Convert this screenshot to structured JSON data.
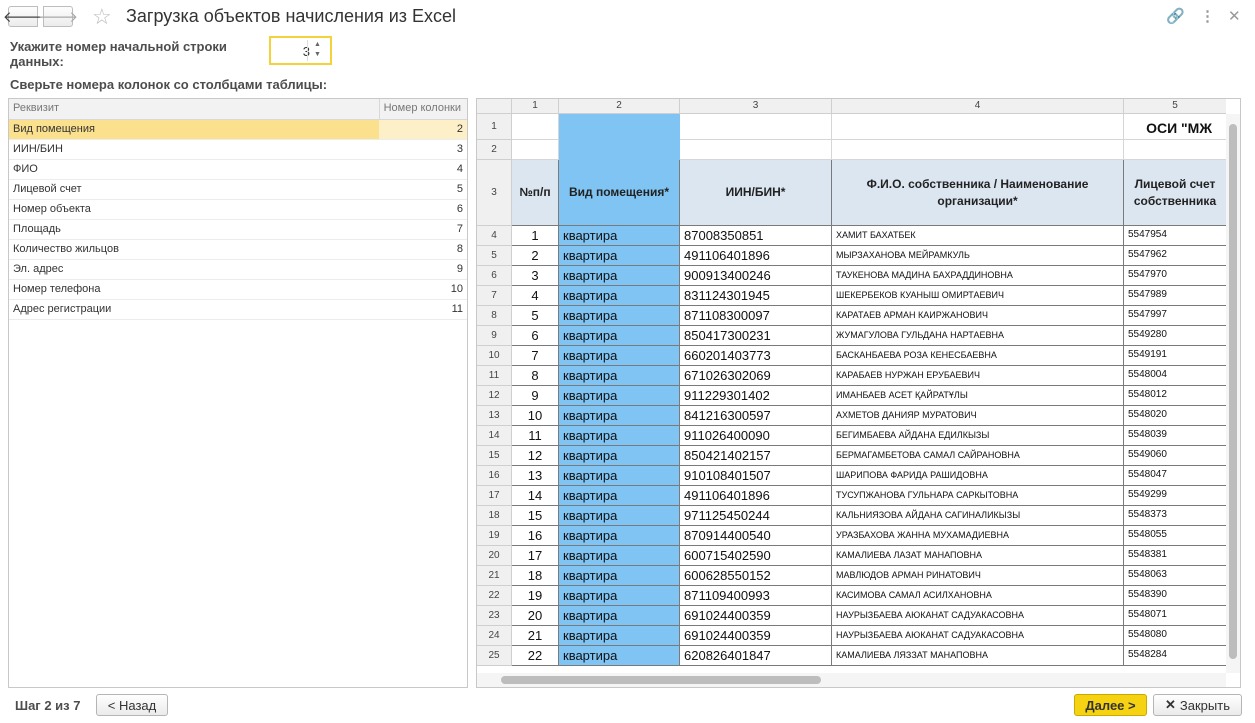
{
  "window": {
    "title": "Загрузка объектов начисления из Excel"
  },
  "form": {
    "start_row_label": "Укажите номер начальной строки данных:",
    "start_row_value": "3",
    "columns_label": "Сверьте номера колонок со столбцами таблицы:"
  },
  "mapping": {
    "headers": [
      "Реквизит",
      "Номер колонки"
    ],
    "rows": [
      {
        "name": "Вид помещения",
        "col": "2"
      },
      {
        "name": "ИИН/БИН",
        "col": "3"
      },
      {
        "name": "ФИО",
        "col": "4"
      },
      {
        "name": "Лицевой счет",
        "col": "5"
      },
      {
        "name": "Номер объекта",
        "col": "6"
      },
      {
        "name": "Площадь",
        "col": "7"
      },
      {
        "name": "Количество жильцов",
        "col": "8"
      },
      {
        "name": "Эл. адрес",
        "col": "9"
      },
      {
        "name": "Номер телефона",
        "col": "10"
      },
      {
        "name": "Адрес регистрации",
        "col": "11"
      }
    ]
  },
  "sheet": {
    "col_numbers": [
      "1",
      "2",
      "3",
      "4",
      "5"
    ],
    "row1_text": "ОСИ \"МЖ",
    "headers": [
      "№п/п",
      "Вид помещения*",
      "ИИН/БИН*",
      "Ф.И.О. собственника / Наименование организации*",
      "Лицевой счет собственника"
    ],
    "rows": [
      {
        "n": "1",
        "kind": "квартира",
        "iin": "87008350851",
        "fio": "ХАМИТ БАХАТБЕК",
        "acc": "5547954"
      },
      {
        "n": "2",
        "kind": "квартира",
        "iin": "491106401896",
        "fio": "МЫРЗАХАНОВА МЕЙРАМКУЛЬ",
        "acc": "5547962"
      },
      {
        "n": "3",
        "kind": "квартира",
        "iin": "900913400246",
        "fio": "ТАУКЕНОВА МАДИНА БАХРАДДИНОВНА",
        "acc": "5547970"
      },
      {
        "n": "4",
        "kind": "квартира",
        "iin": "831124301945",
        "fio": "ШЕКЕРБЕКОВ КУАНЫШ ОМИРТАЕВИЧ",
        "acc": "5547989"
      },
      {
        "n": "5",
        "kind": "квартира",
        "iin": "871108300097",
        "fio": "КАРАТАЕВ АРМАН КАИРЖАНОВИЧ",
        "acc": "5547997"
      },
      {
        "n": "6",
        "kind": "квартира",
        "iin": "850417300231",
        "fio": "ЖУМАГУЛОВА ГУЛЬДАНА НАРТАЕВНА",
        "acc": "5549280"
      },
      {
        "n": "7",
        "kind": "квартира",
        "iin": "660201403773",
        "fio": "БАСКАНБАЕВА РОЗА КЕНЕСБАЕВНА",
        "acc": "5549191"
      },
      {
        "n": "8",
        "kind": "квартира",
        "iin": "671026302069",
        "fio": "КАРАБАЕВ НУРЖАН ЕРУБАЕВИЧ",
        "acc": "5548004"
      },
      {
        "n": "9",
        "kind": "квартира",
        "iin": "911229301402",
        "fio": "ИМАНБАЕВ АСЕТ ҚАЙРАТҰЛЫ",
        "acc": "5548012"
      },
      {
        "n": "10",
        "kind": "квартира",
        "iin": "841216300597",
        "fio": "АХМЕТОВ ДАНИЯР МУРАТОВИЧ",
        "acc": "5548020"
      },
      {
        "n": "11",
        "kind": "квартира",
        "iin": "911026400090",
        "fio": "БЕГИМБАЕВА АЙДАНА ЕДИЛКЫЗЫ",
        "acc": "5548039"
      },
      {
        "n": "12",
        "kind": "квартира",
        "iin": "850421402157",
        "fio": "БЕРМАГАМБЕТОВА САМАЛ САЙРАНОВНА",
        "acc": "5549060"
      },
      {
        "n": "13",
        "kind": "квартира",
        "iin": "910108401507",
        "fio": "ШАРИПОВА ФАРИДА РАШИДОВНА",
        "acc": "5548047"
      },
      {
        "n": "14",
        "kind": "квартира",
        "iin": "491106401896",
        "fio": "ТУСУПЖАНОВА ГУЛЬНАРА САРКЫТОВНА",
        "acc": "5549299"
      },
      {
        "n": "15",
        "kind": "квартира",
        "iin": "971125450244",
        "fio": "КАЛЬНИЯЗОВА АЙДАНА САГИНАЛИКЫЗЫ",
        "acc": "5548373"
      },
      {
        "n": "16",
        "kind": "квартира",
        "iin": "870914400540",
        "fio": "УРАЗБАХОВА ЖАННА МУХАМАДИЕВНА",
        "acc": "5548055"
      },
      {
        "n": "17",
        "kind": "квартира",
        "iin": "600715402590",
        "fio": "КАМАЛИЕВА ЛАЗАТ МАНАПОВНА",
        "acc": "5548381"
      },
      {
        "n": "18",
        "kind": "квартира",
        "iin": "600628550152",
        "fio": "МАВЛЮДОВ АРМАН РИНАТОВИЧ",
        "acc": "5548063"
      },
      {
        "n": "19",
        "kind": "квартира",
        "iin": "871109400993",
        "fio": "КАСИМОВА САМАЛ АСИЛХАНОВНА",
        "acc": "5548390"
      },
      {
        "n": "20",
        "kind": "квартира",
        "iin": "691024400359",
        "fio": "НАУРЫЗБАЕВА АЮКАНАТ САДУАКАСОВНА",
        "acc": "5548071"
      },
      {
        "n": "21",
        "kind": "квартира",
        "iin": "691024400359",
        "fio": "НАУРЫЗБАЕВА АЮКАНАТ САДУАКАСОВНА",
        "acc": "5548080"
      },
      {
        "n": "22",
        "kind": "квартира",
        "iin": "620826401847",
        "fio": "КАМАЛИЕВА ЛЯЗЗАТ МАНАПОВНА",
        "acc": "5548284"
      }
    ]
  },
  "footer": {
    "step": "Шаг 2 из 7",
    "back": "< Назад",
    "next": "Далее >",
    "close": "Закрыть"
  },
  "colors": {
    "accent": "#f5d312",
    "selection": "#fbe08d",
    "header_fill": "#dce6f1",
    "highlight_column": "#7fc4f3"
  },
  "icons": [
    "back-arrow-icon",
    "forward-arrow-icon",
    "favorite-star-icon",
    "link-icon",
    "more-icon",
    "close-icon"
  ]
}
